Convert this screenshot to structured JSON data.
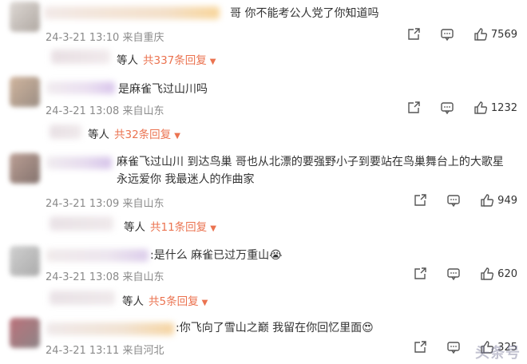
{
  "comments": [
    {
      "text": "哥 你不能考公人党了你知道吗",
      "time": "24-3-21 13:10",
      "location": "来自重庆",
      "likes": "7569",
      "reply_who": "等人",
      "reply_total": "共337条回复"
    },
    {
      "text": "是麻雀飞过山川吗",
      "time": "24-3-21 13:08",
      "location": "来自山东",
      "likes": "1232",
      "reply_who": "等人",
      "reply_total": "共32条回复"
    },
    {
      "text": "麻雀飞过山川 到达鸟巢 哥也从北漂的要强野小子到要站在鸟巢舞台上的大歌星 永远爱你 我最迷人的作曲家",
      "time": "24-3-21 13:09",
      "location": "来自山东",
      "likes": "949",
      "reply_who": "等人",
      "reply_total": "共11条回复"
    },
    {
      "text": ":是什么 麻雀已过万重山😭",
      "time": "24-3-21 13:08",
      "location": "来自山东",
      "likes": "620",
      "reply_who": "等人",
      "reply_total": "共5条回复"
    },
    {
      "text": ":你飞向了雪山之巅 我留在你回忆里面😍",
      "time": "24-3-21 13:11",
      "location": "来自河北",
      "likes": "325"
    }
  ],
  "icons": {
    "share": "share-icon",
    "comment": "comment-icon",
    "like": "thumbs-up-icon",
    "caret": "caret-down-icon"
  },
  "watermark": "头条号"
}
